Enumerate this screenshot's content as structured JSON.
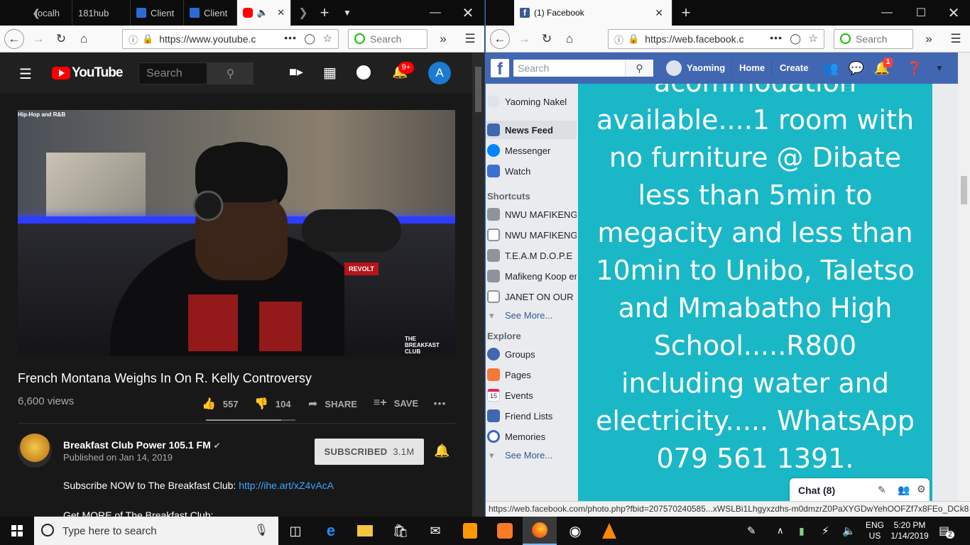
{
  "left_window": {
    "tabs": [
      {
        "label": "localh"
      },
      {
        "label": "181hub"
      },
      {
        "label": "Client"
      },
      {
        "label": "Client"
      },
      {
        "label": ""
      }
    ],
    "url": "https://www.youtube.c",
    "search_placeholder": "Search",
    "youtube": {
      "logo_text": "YouTube",
      "search_placeholder": "Search",
      "notification_count": "9+",
      "account_initial": "A",
      "video_overlay_label": "Hip-Hop and R&B",
      "video_watermark": "THE BREAKFAST CLUB",
      "video_mic_label": "REVOLT",
      "video_title": "French Montana Weighs In On R. Kelly Controversy",
      "views": "6,600 views",
      "likes": "557",
      "dislikes": "104",
      "share_label": "SHARE",
      "save_label": "SAVE",
      "like_ratio": 0.84,
      "channel_name": "Breakfast Club Power 105.1 FM",
      "published": "Published on Jan 14, 2019",
      "subscribe_label": "SUBSCRIBED",
      "subscriber_count": "3.1M",
      "description_line1": "Subscribe NOW to The Breakfast Club: ",
      "description_link": "http://ihe.art/xZ4vAcA",
      "description_line2": "Get MORE of The Breakfast Club:"
    }
  },
  "right_window": {
    "tab_title": "(1) Facebook",
    "url": "https://web.facebook.c",
    "search_placeholder": "Search",
    "facebook": {
      "search_placeholder": "Search",
      "user_name": "Yaoming",
      "nav_home": "Home",
      "nav_create": "Create",
      "notification_count": "1",
      "sidebar": {
        "profile_name": "Yaoming Nakel",
        "main_items": [
          "News Feed",
          "Messenger",
          "Watch"
        ],
        "shortcuts_heading": "Shortcuts",
        "shortcuts": [
          "NWU MAFIKENG",
          "NWU MAFIKENG",
          "T.E.A.M D.O.P.E",
          "Mafikeng Koop en",
          "JANET ON OUR I"
        ],
        "see_more_1": "See More...",
        "explore_heading": "Explore",
        "explore": [
          "Groups",
          "Pages",
          "Events",
          "Friend Lists",
          "Memories"
        ],
        "see_more_2": "See More...",
        "events_day": "15"
      },
      "post_text_lines": [
        "acommodation",
        "available....1 room with",
        "no furniture @ Dibate",
        "less than 5min to",
        "megacity and less than",
        "10min to Unibo, Taletso",
        "and Mmabatho High",
        "School.....R800",
        "including water and",
        "electricity..... WhatsApp",
        "079 561 1391."
      ],
      "chat_label": "Chat (8)"
    },
    "status_url": "https://web.facebook.com/photo.php?fbid=207570240585...xWSLBi1Lhgyxzdhs-m0dmzrZ0PaXYGDwYehOOFZf7x8FEo_DCk8"
  },
  "taskbar": {
    "search_placeholder": "Type here to search",
    "language_top": "ENG",
    "language_bottom": "US",
    "time": "5:20 PM",
    "date": "1/14/2019",
    "notification_count": "2"
  },
  "colors": {
    "youtube_red": "#ff0000",
    "facebook_blue": "#4267b2",
    "post_background": "#1ab7c7",
    "notification_red": "#fa3e3e"
  }
}
